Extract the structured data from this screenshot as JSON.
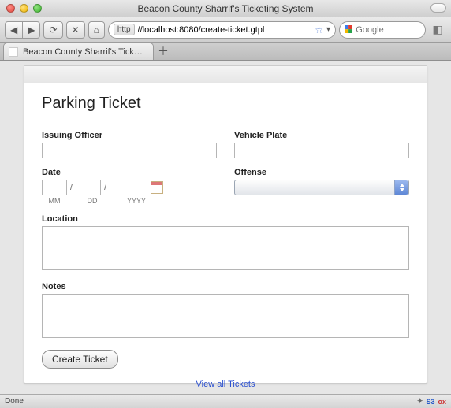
{
  "window": {
    "title": "Beacon County Sharrif's Ticketing System"
  },
  "toolbar": {
    "scheme": "http",
    "url": "//localhost:8080/create-ticket.gtpl",
    "search_placeholder": "Google"
  },
  "tab": {
    "title": "Beacon County Sharrif's Ticketing ..."
  },
  "page": {
    "heading": "Parking Ticket",
    "labels": {
      "officer": "Issuing Officer",
      "plate": "Vehicle Plate",
      "date": "Date",
      "offense": "Offense",
      "location": "Location",
      "notes": "Notes"
    },
    "date_hints": {
      "mm": "MM",
      "dd": "DD",
      "yyyy": "YYYY"
    },
    "values": {
      "officer": "",
      "plate": "",
      "mm": "",
      "dd": "",
      "yyyy": "",
      "offense": "",
      "location": "",
      "notes": ""
    },
    "submit_label": "Create Ticket",
    "view_all": "View all Tickets"
  },
  "status": {
    "left": "Done",
    "badges": [
      "✦",
      "S3",
      "ox"
    ]
  }
}
